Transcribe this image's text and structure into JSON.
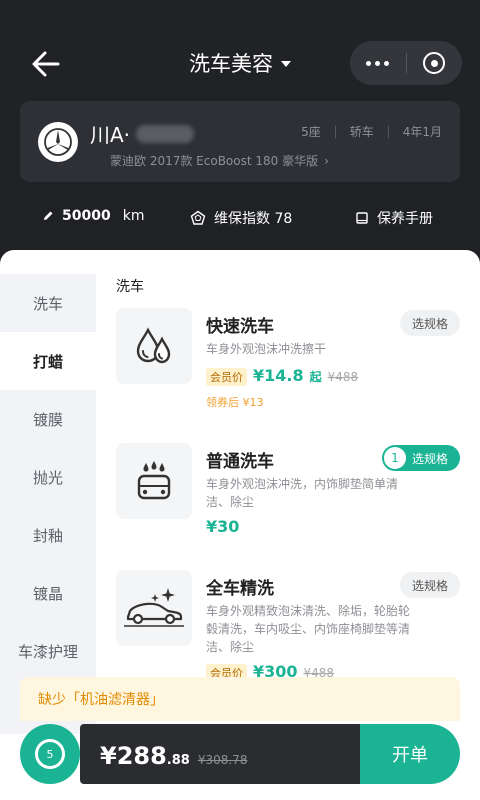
{
  "header": {
    "title": "洗车美容"
  },
  "car": {
    "plate_prefix": "川A·",
    "seats": "5座",
    "body": "轿车",
    "age": "4年1月",
    "model": "蒙迪欧 2017款 EcoBoost 180 豪华版"
  },
  "stats": {
    "mileage_value": "50000",
    "mileage_unit": "km",
    "maintenance_index": "维保指数 78",
    "manual": "保养手册"
  },
  "sidebar": {
    "items": [
      {
        "label": "洗车"
      },
      {
        "label": "打蜡"
      },
      {
        "label": "镀膜"
      },
      {
        "label": "抛光"
      },
      {
        "label": "封釉"
      },
      {
        "label": "镀晶"
      },
      {
        "label": "车漆护理"
      }
    ],
    "active_index": 1
  },
  "section": {
    "title": "洗车"
  },
  "services": [
    {
      "name": "快速洗车",
      "desc": "车身外观泡沫冲洗擦干",
      "member_tag": "会员价",
      "price": "¥14.8",
      "price_suffix": "起",
      "orig_price": "¥488",
      "coupon": "领券后 ¥13",
      "spec_label": "选规格"
    },
    {
      "name": "普通洗车",
      "desc": "车身外观泡沫冲洗，内饰脚垫简单清洁、除尘",
      "price": "¥30",
      "spec_label": "选规格",
      "spec_count": "1"
    },
    {
      "name": "全车精洗",
      "desc": "车身外观精致泡沫清洗、除垢，轮胎轮毂清洗，车内吸尘、内饰座椅脚垫等清洁、除尘",
      "member_tag": "会员价",
      "price": "¥300",
      "orig_price": "¥488",
      "spec_label": "选规格"
    }
  ],
  "warning": "缺少「机油滤清器」",
  "cart": {
    "count": "5",
    "total_main": "¥288",
    "total_decimal": ".88",
    "orig_total": "¥308.78",
    "submit_label": "开单"
  },
  "colors": {
    "accent": "#1ab394",
    "header_bg": "#202226",
    "warning_text": "#e08a00"
  }
}
